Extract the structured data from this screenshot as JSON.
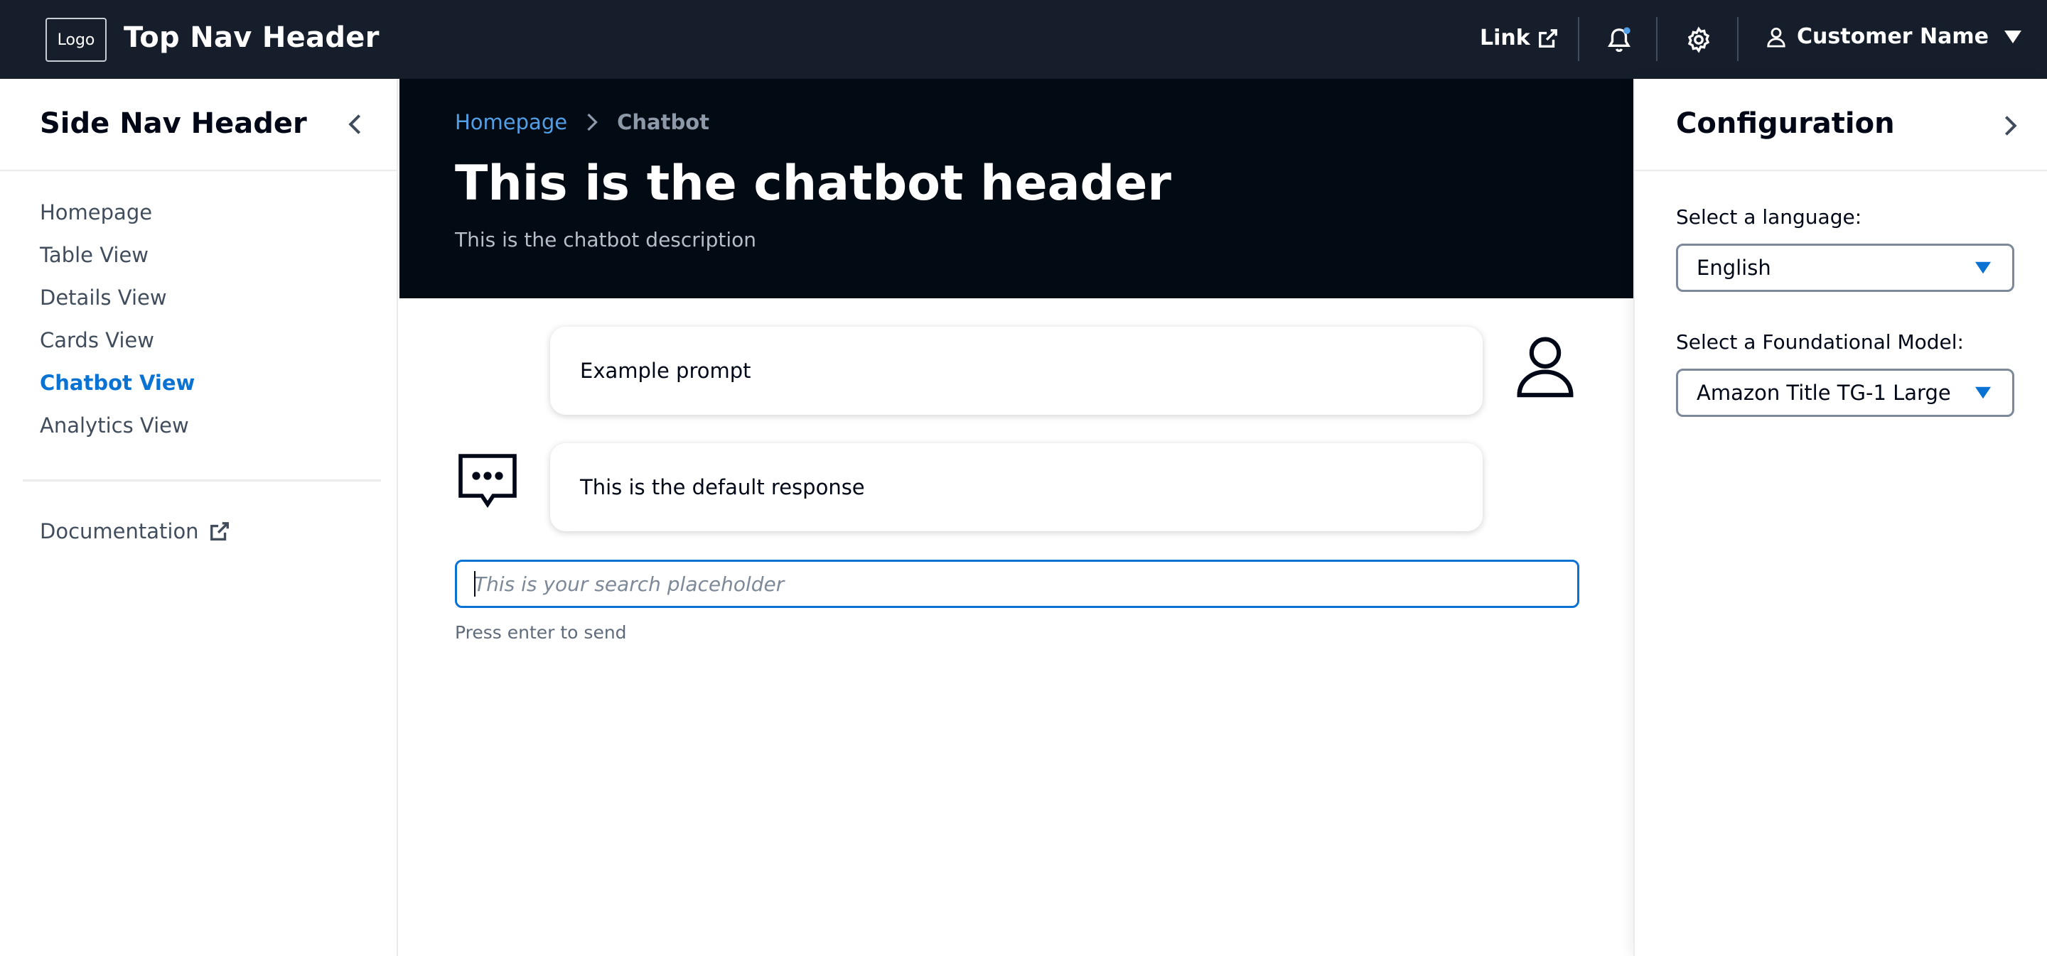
{
  "topnav": {
    "logo": "Logo",
    "title": "Top Nav Header",
    "link_label": "Link",
    "link_icon": "external-link-icon",
    "notification_icon": "bell-icon",
    "settings_icon": "gear-icon",
    "user_icon": "user-icon",
    "user_name": "Customer Name",
    "dropdown_icon": "caret-down-icon",
    "notification_dot_color": "#539fe5"
  },
  "sidenav": {
    "header": "Side Nav Header",
    "collapse_icon": "chevron-left-icon",
    "items": [
      {
        "label": "Homepage",
        "active": false
      },
      {
        "label": "Table View",
        "active": false
      },
      {
        "label": "Details View",
        "active": false
      },
      {
        "label": "Cards View",
        "active": false
      },
      {
        "label": "Chatbot View",
        "active": true
      },
      {
        "label": "Analytics View",
        "active": false
      }
    ],
    "documentation_label": "Documentation",
    "documentation_icon": "external-link-icon"
  },
  "main": {
    "breadcrumb": [
      {
        "label": "Homepage"
      },
      {
        "label": "Chatbot"
      }
    ],
    "title": "This is the chatbot header",
    "description": "This is the chatbot description",
    "messages": [
      {
        "role": "user",
        "text": "Example prompt",
        "avatar_icon": "user-avatar-icon"
      },
      {
        "role": "bot",
        "text": "This is the default response",
        "avatar_icon": "chat-bubble-icon"
      }
    ],
    "input": {
      "value": "",
      "placeholder": "This is your search placeholder",
      "hint": "Press enter to send"
    }
  },
  "config": {
    "title": "Configuration",
    "close_icon": "chevron-right-icon",
    "language_label": "Select a language:",
    "language_value": "English",
    "model_label": "Select a Foundational Model:",
    "model_value": "Amazon Title TG-1 Large"
  },
  "colors": {
    "topnav_bg": "#161d2b",
    "hero_bg": "#020a14",
    "accent": "#0972d3",
    "breadcrumb_link": "#539fe5"
  }
}
